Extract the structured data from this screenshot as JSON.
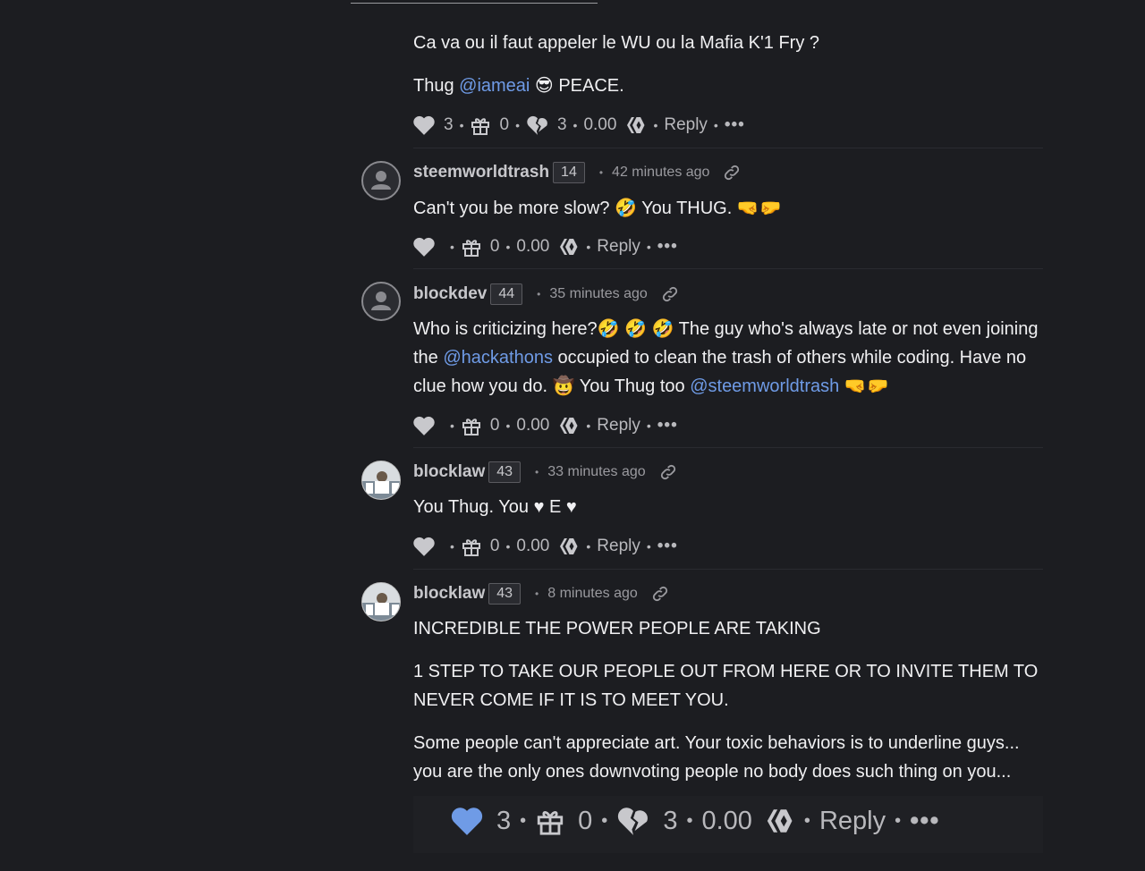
{
  "comments": [
    {
      "paragraphs": [
        {
          "text": "Ca va ou il faut appeler le WU ou la Mafia K'1 Fry ?"
        },
        {
          "before": "Thug ",
          "mention": "@iameai",
          "after": " 😎 PEACE."
        }
      ],
      "actions": {
        "upvotes": "3",
        "gifts": "0",
        "downvotes": "3",
        "payout": "0.00",
        "reply": "Reply",
        "more": "•••"
      }
    },
    {
      "author": "steemworldtrash",
      "reputation": "14",
      "time": "42 minutes ago",
      "paragraphs": [
        {
          "text": "Can't you be more slow? 🤣 You THUG. 🤜🤛"
        }
      ],
      "actions": {
        "gifts": "0",
        "payout": "0.00",
        "reply": "Reply",
        "more": "•••"
      }
    },
    {
      "author": "blockdev",
      "reputation": "44",
      "time": "35 minutes ago",
      "paragraphs": [
        {
          "text": "Who is criticizing here?🤣 🤣 🤣 The guy who's always late or not even joining the ",
          "mention": "@hackathons",
          "after": " occupied to clean the trash of others while coding. Have no clue how you do. 🤠 You Thug too ",
          "mention2": "@steemworldtrash",
          "after2": " 🤜🤛"
        }
      ],
      "actions": {
        "gifts": "0",
        "payout": "0.00",
        "reply": "Reply",
        "more": "•••"
      }
    },
    {
      "author": "blocklaw",
      "reputation": "43",
      "time": "33 minutes ago",
      "paragraphs": [
        {
          "text": "You Thug. You ♥ E ♥"
        }
      ],
      "actions": {
        "gifts": "0",
        "payout": "0.00",
        "reply": "Reply",
        "more": "•••"
      }
    },
    {
      "author": "blocklaw",
      "reputation": "43",
      "time": "8 minutes ago",
      "paragraphs": [
        {
          "text": "INCREDIBLE THE POWER PEOPLE ARE TAKING"
        },
        {
          "text": "1 STEP TO TAKE OUR PEOPLE OUT FROM HERE OR TO INVITE THEM TO NEVER COME IF IT IS TO MEET YOU."
        },
        {
          "text": "Some people can't appreciate art. Your toxic behaviors is to underline guys... you are the only ones downvoting people no body does such thing on you..."
        }
      ],
      "actions": {
        "upvotes": "3",
        "gifts": "0",
        "downvotes": "3",
        "payout": "0.00",
        "reply": "Reply",
        "more": "•••"
      }
    }
  ],
  "colors": {
    "background": "#1c1d21",
    "mention": "#6f9be6",
    "upvote_active": "#6f9be6",
    "icon": "#c8c8cc"
  }
}
